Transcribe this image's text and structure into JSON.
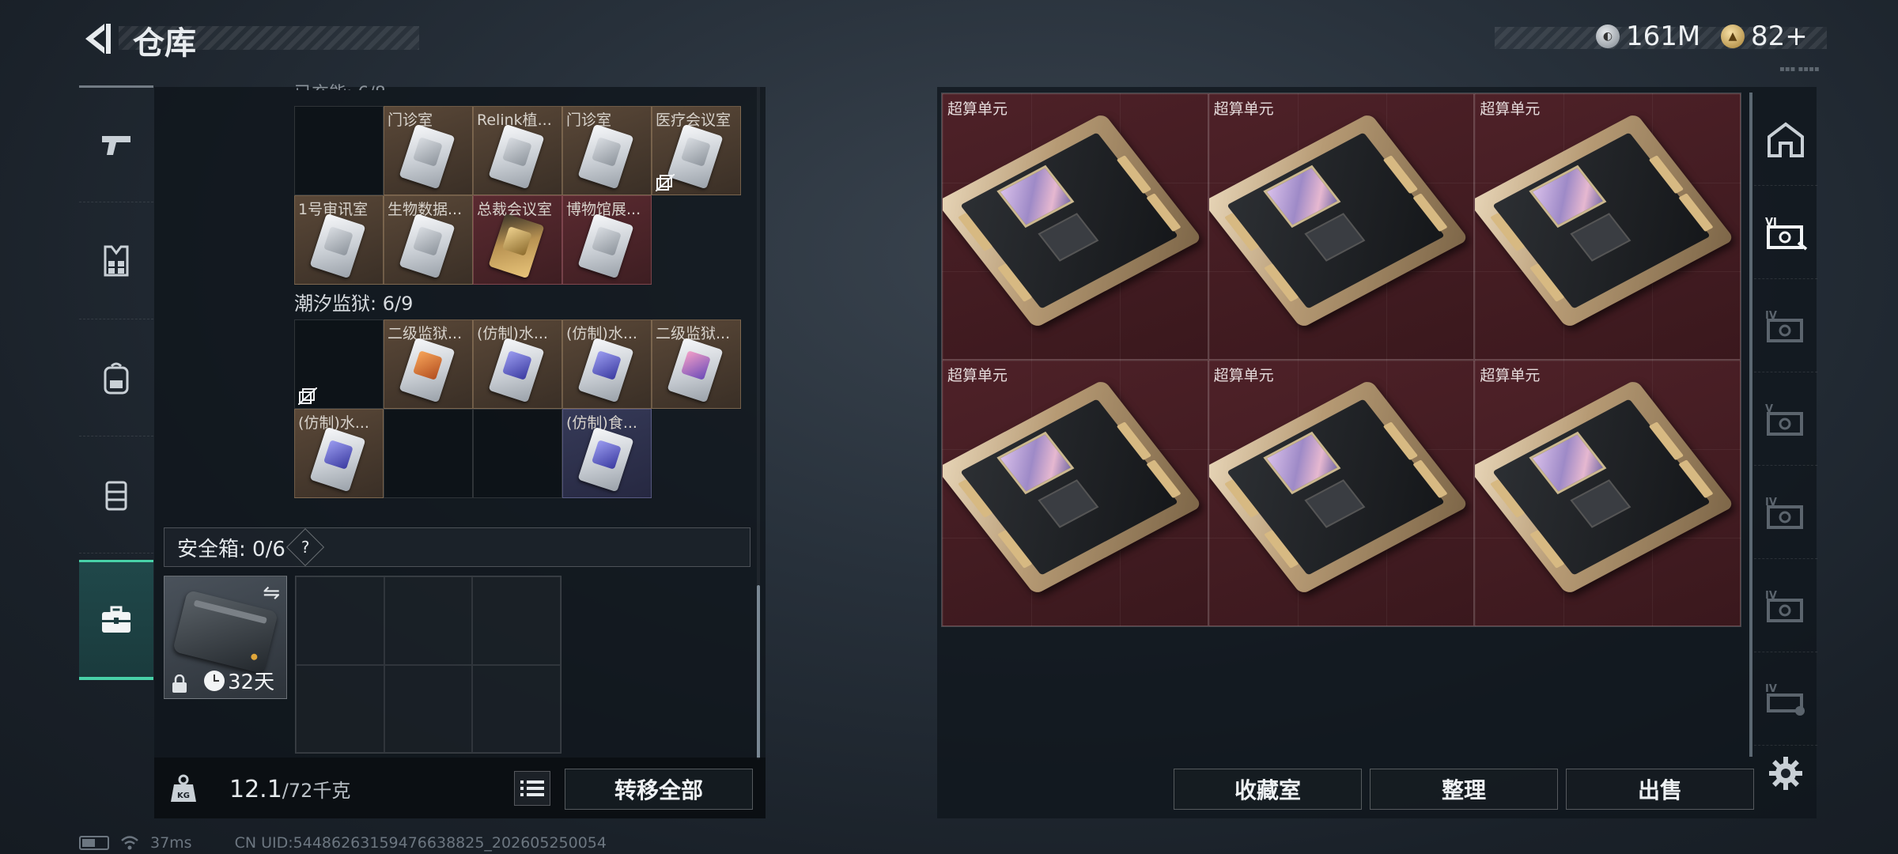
{
  "header": {
    "title": "仓库",
    "currencies": [
      {
        "icon": "silver-coin-icon",
        "value": "161M"
      },
      {
        "icon": "gold-coin-icon",
        "value": "82+"
      }
    ]
  },
  "sidebar": {
    "items": [
      {
        "name": "weapons",
        "icon": "pistol-icon"
      },
      {
        "name": "armor",
        "icon": "vest-icon"
      },
      {
        "name": "backpack",
        "icon": "backpack-icon"
      },
      {
        "name": "chest-rig",
        "icon": "rig-icon"
      },
      {
        "name": "safebox",
        "icon": "briefcase-icon",
        "active": true
      }
    ]
  },
  "keycards": {
    "group1": {
      "cells": [
        {
          "label": "",
          "card": null,
          "bg": "empty"
        },
        {
          "label": "门诊室",
          "card": "white",
          "bg": "brown"
        },
        {
          "label": "Relink植...",
          "card": "white",
          "bg": "brown"
        },
        {
          "label": "门诊室",
          "card": "white",
          "bg": "brown"
        },
        {
          "label": "医疗会议室",
          "card": "white",
          "bg": "brown",
          "no_bind": true
        },
        {
          "label": "1号审讯室",
          "card": "white",
          "bg": "brown"
        },
        {
          "label": "生物数据...",
          "card": "white",
          "bg": "brown"
        },
        {
          "label": "总裁会议室",
          "card": "gold",
          "bg": "red"
        },
        {
          "label": "博物馆展...",
          "card": "white",
          "bg": "red"
        }
      ]
    },
    "group2": {
      "title": "潮汐监狱: 6/9",
      "cells": [
        {
          "label": "",
          "card": null,
          "bg": "empty",
          "no_bind": true
        },
        {
          "label": "二级监狱...",
          "card": "orange",
          "bg": "brown"
        },
        {
          "label": "(仿制)水...",
          "card": "purple",
          "bg": "brown"
        },
        {
          "label": "(仿制)水...",
          "card": "purple",
          "bg": "brown"
        },
        {
          "label": "二级监狱...",
          "card": "purplepink",
          "bg": "brown"
        },
        {
          "label": "(仿制)水...",
          "card": "purple",
          "bg": "brown"
        },
        {
          "label": "",
          "card": null,
          "bg": "empty"
        },
        {
          "label": "",
          "card": null,
          "bg": "empty"
        },
        {
          "label": "(仿制)食...",
          "card": "purple",
          "bg": "navy"
        },
        {
          "label": "",
          "card": null,
          "bg": "hidden"
        }
      ]
    }
  },
  "safebox": {
    "label": "安全箱: 0/6",
    "help": "?",
    "case_days": "32天",
    "swap_icon": "swap-icon"
  },
  "weight": {
    "current": "12.1",
    "capacity": "/72千克"
  },
  "buttons": {
    "transfer_all": "转移全部",
    "collection": "收藏室",
    "organize": "整理",
    "sell": "出售"
  },
  "storage": {
    "items": [
      {
        "label": "超算单元"
      },
      {
        "label": "超算单元"
      },
      {
        "label": "超算单元"
      },
      {
        "label": "超算单元"
      },
      {
        "label": "超算单元"
      },
      {
        "label": "超算单元"
      }
    ]
  },
  "right_sidebar": {
    "items": [
      {
        "icon": "home-icon"
      },
      {
        "icon": "storage-vi-icon",
        "active": true
      },
      {
        "icon": "storage-iv-icon"
      },
      {
        "icon": "storage-v-icon"
      },
      {
        "icon": "storage-iv-icon"
      },
      {
        "icon": "storage-iv-icon"
      },
      {
        "icon": "storage-iv-lock-icon"
      }
    ]
  },
  "status": {
    "ping": "37ms",
    "uid": "CN UID:54486263159476638825_202605250054"
  }
}
